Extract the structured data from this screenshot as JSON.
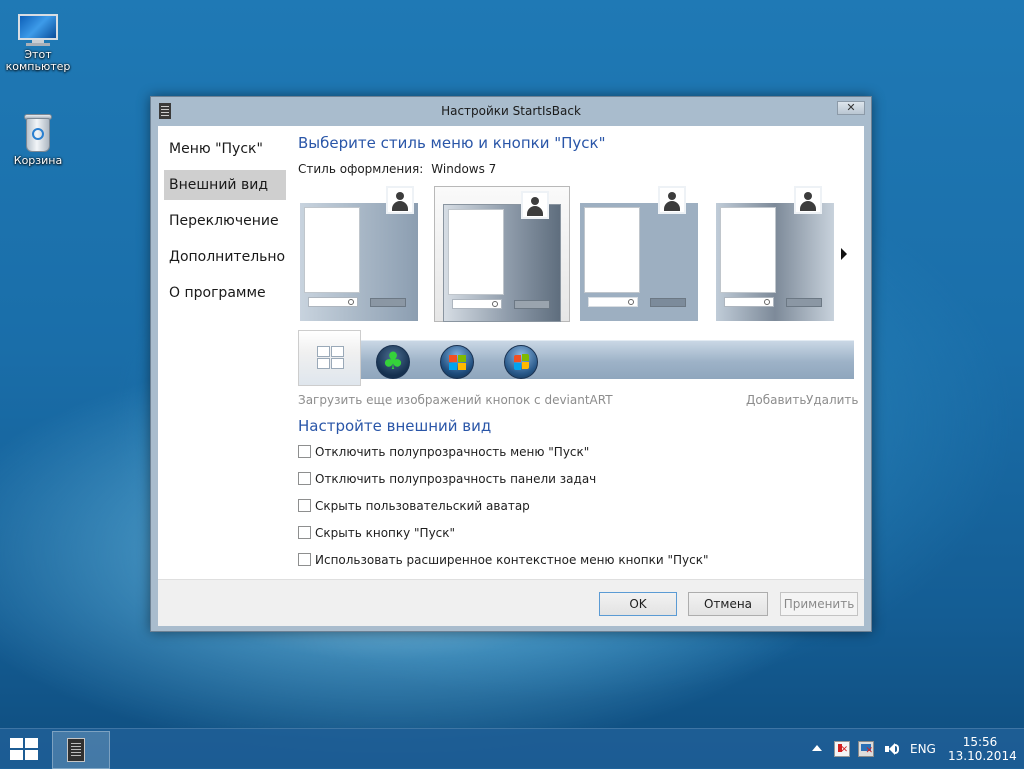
{
  "desktop": {
    "icons": [
      {
        "label_line1": "Этот",
        "label_line2": "компьютер"
      },
      {
        "label_line1": "Корзина"
      }
    ]
  },
  "window": {
    "title": "Настройки StartIsBack",
    "close_glyph": "✕",
    "nav": [
      "Меню \"Пуск\"",
      "Внешний вид",
      "Переключение",
      "Дополнительно",
      "О программе"
    ],
    "active_nav_index": 1,
    "section_title": "Выберите стиль меню и кнопки \"Пуск\"",
    "style_label": "Стиль оформления:",
    "style_value": "Windows 7",
    "styles_selected_index": 1,
    "more_buttons_link": "Загрузить еще изображений кнопок с deviantART",
    "add_link": "Добавить",
    "remove_link": "Удалить",
    "appearance_title": "Настройте внешний вид",
    "checkboxes": [
      {
        "label": "Отключить полупрозрачность меню \"Пуск\"",
        "checked": false
      },
      {
        "label": "Отключить полупрозрачность панели задач",
        "checked": false
      },
      {
        "label": "Скрыть пользовательский аватар",
        "checked": false
      },
      {
        "label": "Скрыть кнопку \"Пуск\"",
        "checked": false
      },
      {
        "label": "Использовать расширенное контекстное меню кнопки \"Пуск\"",
        "checked": false
      }
    ],
    "buttons": {
      "ok": "OK",
      "cancel": "Отмена",
      "apply": "Применить"
    }
  },
  "taskbar": {
    "language": "ENG",
    "time": "15:56",
    "date": "13.10.2014"
  },
  "colors": {
    "heading": "#2a56a8",
    "taskbar": "#1f5f96"
  }
}
